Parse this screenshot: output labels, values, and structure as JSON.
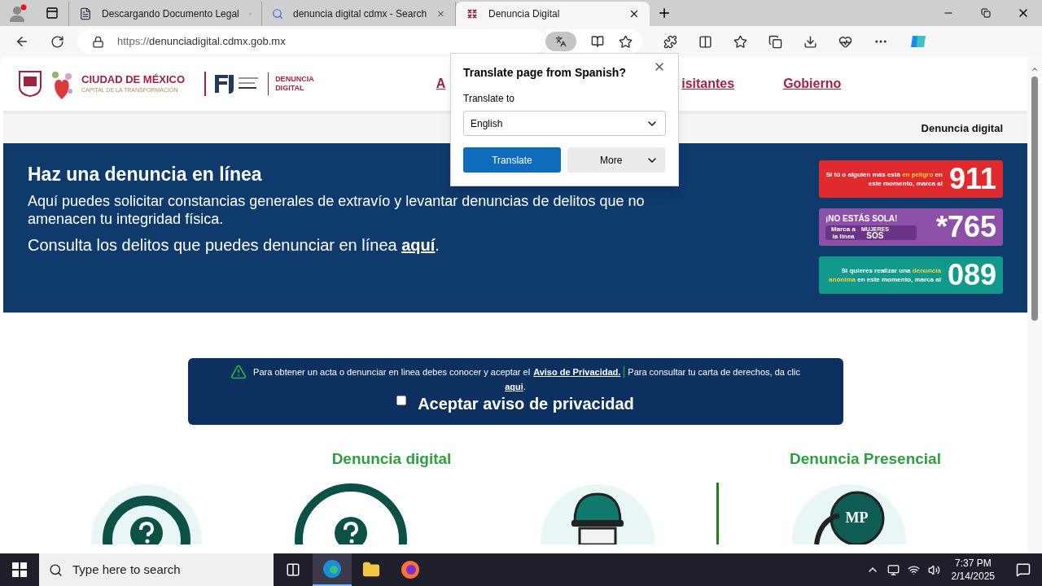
{
  "browser": {
    "tabs": [
      {
        "title": "Descargando Documento Legal",
        "kind": "document",
        "selected": false
      },
      {
        "title": "denuncia digital cdmx - Search",
        "kind": "search",
        "selected": false
      },
      {
        "title": "Denuncia Digital",
        "kind": "site",
        "selected": true
      }
    ],
    "url_scheme": "https://",
    "url_host": "denunciadigital.cdmx.gob.mx"
  },
  "translate_popup": {
    "title": "Translate page from Spanish?",
    "label": "Translate to",
    "value": "English",
    "buttons": [
      {
        "label": "Translate",
        "kind": "primary"
      },
      {
        "label": "More",
        "kind": "menu"
      }
    ]
  },
  "header": {
    "city_name": "CIUDAD DE MÉXICO",
    "city_motto": "CAPITAL DE LA TRANSFORMACIÓN",
    "site_name": [
      "DENUNCIA",
      "DIGITAL"
    ],
    "nav": [
      "A",
      "isitantes",
      "Gobierno"
    ]
  },
  "breadcrumb": "Denuncia digital",
  "banner": {
    "title": "Haz una denuncia en línea",
    "text": "Aquí puedes solicitar constancias generales de extravío y levantar denuncias de delitos que no amenacen tu integridad física.",
    "consult": "Consulta los delitos que puedes denunciar en línea",
    "consult_link": "aquí",
    "consult_end": ".",
    "hotlines": [
      {
        "kind": "message",
        "text": "Si tú o alguien más está **en peligro** en este momento, marca al",
        "number": "911",
        "color": "#e02a2d"
      },
      {
        "kind": "sos",
        "heading": "¡NO ESTÁS SOLA!",
        "text": "Marca a la línea",
        "badge_top": "MUJERES",
        "badge": "SOS",
        "number": "*765",
        "color": "#8d50a8"
      },
      {
        "kind": "message",
        "text": "Si quieres realizar una **denuncia anónima** en este momento, marca al",
        "number": "089",
        "color": "#119a8c"
      }
    ]
  },
  "privacy": {
    "text": "Para obtener un acta o denunciar en linea debes conocer y aceptar el",
    "link": "Aviso de Privacidad.",
    "text2": "Para consultar tu carta de derechos, da clic",
    "link2": "aqui",
    "end": ".",
    "checkbox": {
      "label": "Aceptar aviso de privacidad",
      "checked": false
    }
  },
  "sections": [
    {
      "title": "Denuncia digital"
    },
    {
      "title": "Denuncia Presencial"
    }
  ],
  "cards": [
    {
      "kind": "question"
    },
    {
      "kind": "question_ring"
    },
    {
      "kind": "officer"
    },
    {
      "kind": "mp",
      "badge": "MP"
    }
  ],
  "taskbar": {
    "search_placeholder": "Type here to search",
    "time": "7:37 PM",
    "date": "2/14/2025"
  }
}
